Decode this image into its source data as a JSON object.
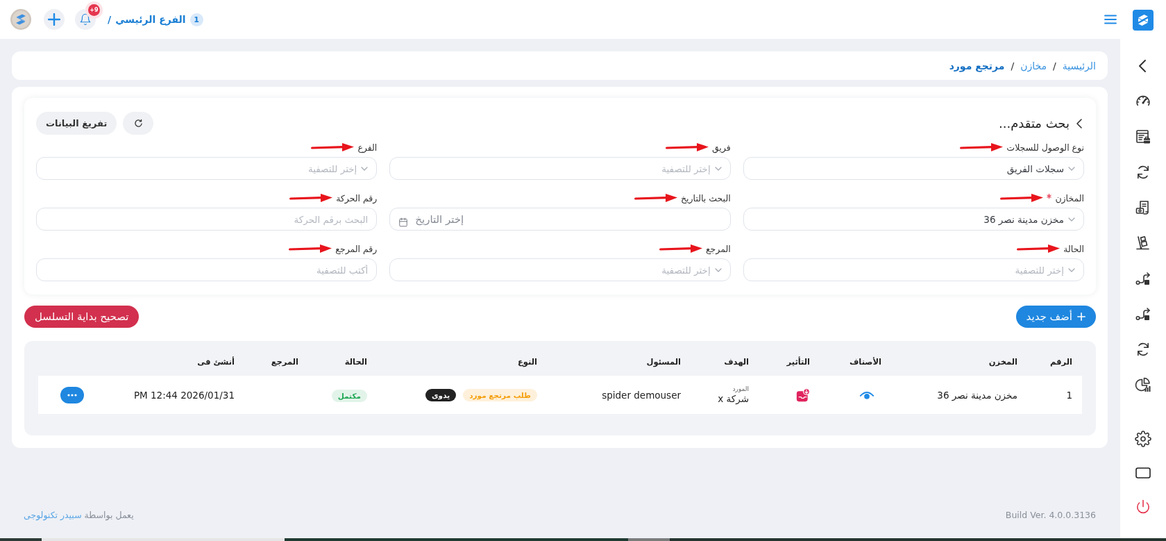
{
  "header": {
    "branch_number": "1",
    "branch_name": "الفرع الرئيسي",
    "branch_separator": "/",
    "notification_count": "+9"
  },
  "breadcrumb": [
    {
      "label": "الرئيسية",
      "current": false,
      "separator": "/"
    },
    {
      "label": "مخازن",
      "current": false,
      "separator": "/"
    },
    {
      "label": "مرتجع مورد",
      "current": true
    }
  ],
  "search_panel": {
    "title": "بحث متقدم...",
    "clear_button": "تفريغ البيانات",
    "filters": [
      {
        "label": "نوع الوصول للسجلات",
        "kind": "select",
        "value": "سجلات الفريق",
        "required": false,
        "pointer_arrow": true
      },
      {
        "label": "فريق",
        "kind": "select",
        "placeholder": "إختر للتصفية",
        "required": false,
        "pointer_arrow": true
      },
      {
        "label": "الفرع",
        "kind": "select",
        "placeholder": "إختر للتصفية",
        "required": false,
        "pointer_arrow": true
      },
      {
        "label": "المخازن",
        "kind": "select",
        "value": "مخزن مدينة نصر 36",
        "required": true,
        "pointer_arrow": true
      },
      {
        "label": "البحث بالتاريخ",
        "kind": "date",
        "placeholder": "إختر التاريخ",
        "required": false,
        "pointer_arrow": true
      },
      {
        "label": "رقم الحركة",
        "kind": "text",
        "placeholder": "البحث برقم الحركة",
        "required": false,
        "pointer_arrow": true
      },
      {
        "label": "الحالة",
        "kind": "select",
        "placeholder": "إختر للتصفية",
        "required": false,
        "pointer_arrow": true
      },
      {
        "label": "المرجع",
        "kind": "select",
        "placeholder": "إختر للتصفية",
        "required": false,
        "pointer_arrow": true
      },
      {
        "label": "رقم المرجع",
        "kind": "text",
        "placeholder": "أكتب للتصفية",
        "required": false,
        "pointer_arrow": true
      }
    ]
  },
  "actions": {
    "add_button": "أضف جديد",
    "fix_sequence_button": "تصحيح بداية التسلسل"
  },
  "table": {
    "columns": [
      "الرقم",
      "المخزن",
      "الأصناف",
      "التأثير",
      "الهدف",
      "المسئول",
      "النوع",
      "الحالة",
      "المرجع",
      "أنشئ فى"
    ],
    "rows": [
      {
        "number": "1",
        "warehouse": "مخزن مدينة نصر 36",
        "stock_out": true,
        "target_label": "المورد",
        "target": "شركة x",
        "responsible": "spider demouser",
        "type_tags": [
          {
            "text": "طلب مرتجع مورد",
            "kind": "soft",
            "color": "#f59e0b"
          },
          {
            "text": "يدوى",
            "kind": "solid",
            "color": "#222222"
          }
        ],
        "status": {
          "text": "مكتمل",
          "color": "#1fa855"
        },
        "created_at": "PM 12:44 2026/01/31"
      }
    ]
  },
  "footer": {
    "build": "Build Ver. 4.0.0.3136",
    "powered_by": "يعمل بواسطة",
    "company": "سبيدر تكنولوجى"
  }
}
